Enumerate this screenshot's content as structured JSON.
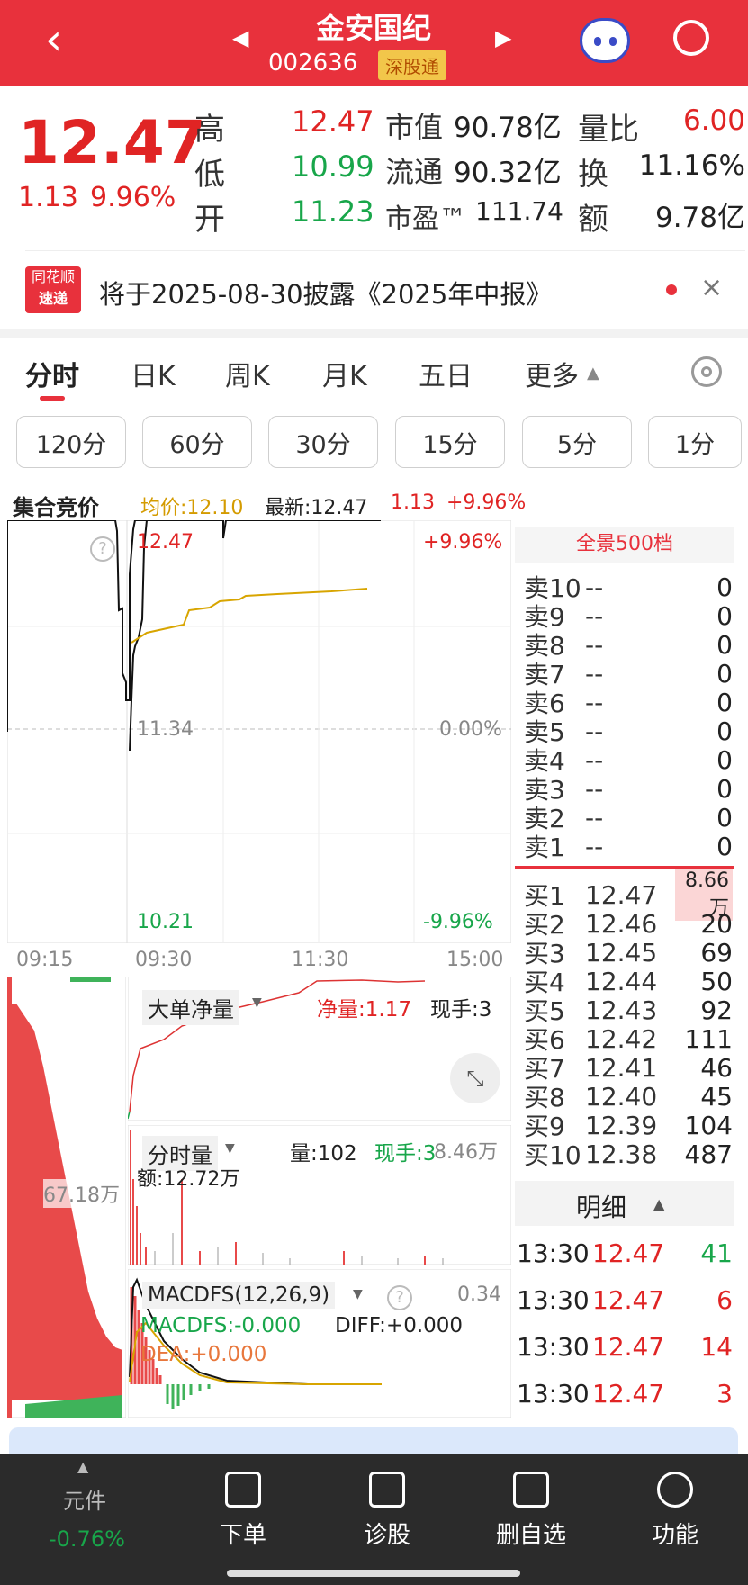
{
  "header": {
    "title": "金安国纪",
    "code": "002636",
    "tag": "深股通"
  },
  "quote": {
    "price": "12.47",
    "change": "1.13",
    "change_pct": "9.96%",
    "rows": [
      {
        "a_label": "高",
        "a_val": "12.47",
        "b_label": "市值",
        "b_val": "90.78亿",
        "c_label": "量比",
        "c_val": "6.00"
      },
      {
        "a_label": "低",
        "a_val": "10.99",
        "b_label": "流通",
        "b_val": "90.32亿",
        "c_label": "换",
        "c_val": "11.16%"
      },
      {
        "a_label": "开",
        "a_val": "11.23",
        "b_label": "市盈™",
        "b_val": "111.74",
        "c_label": "额",
        "c_val": "9.78亿"
      }
    ]
  },
  "notice": {
    "badge_top": "同花顺",
    "badge_bottom": "速递",
    "text": "将于2025-08-30披露《2025年中报》"
  },
  "tabs": [
    "分时",
    "日K",
    "周K",
    "月K",
    "五日",
    "更多"
  ],
  "periods": [
    "120分",
    "60分",
    "30分",
    "15分",
    "5分",
    "1分"
  ],
  "chart": {
    "auction_label": "集合竞价",
    "avg_label": "均价:12.10",
    "latest_label": "最新:12.47",
    "chg": "1.13",
    "chg_pct": "+9.96%",
    "y_top": "12.47",
    "y_top_pct": "+9.96%",
    "y_mid": "11.34",
    "y_mid_pct": "0.00%",
    "y_bot": "10.21",
    "y_bot_pct": "-9.96%",
    "t1": "09:15",
    "t2": "09:30",
    "t3": "11:30",
    "t4": "15:00",
    "net_label": "大单净量",
    "net_value": "净量:1.17",
    "net_hand": "现手:3",
    "vol_label": "分时量",
    "vol_qty": "量:102",
    "vol_hand": "现手:3",
    "vol_right": "8.46万",
    "vol_amt": "额:12.72万",
    "auction_vol": "67.18万",
    "macd_label": "MACDFS(12,26,9)",
    "macd_right": "0.34",
    "macd_val": "MACDFS:-0.000",
    "diff_val": "DIFF:+0.000",
    "dea_val": "DEA:+0.000"
  },
  "orderbook": {
    "title": "全景500档",
    "asks": [
      {
        "label": "卖10",
        "price": "--",
        "qty": "0"
      },
      {
        "label": "卖9",
        "price": "--",
        "qty": "0"
      },
      {
        "label": "卖8",
        "price": "--",
        "qty": "0"
      },
      {
        "label": "卖7",
        "price": "--",
        "qty": "0"
      },
      {
        "label": "卖6",
        "price": "--",
        "qty": "0"
      },
      {
        "label": "卖5",
        "price": "--",
        "qty": "0"
      },
      {
        "label": "卖4",
        "price": "--",
        "qty": "0"
      },
      {
        "label": "卖3",
        "price": "--",
        "qty": "0"
      },
      {
        "label": "卖2",
        "price": "--",
        "qty": "0"
      },
      {
        "label": "卖1",
        "price": "--",
        "qty": "0"
      }
    ],
    "bids": [
      {
        "label": "买1",
        "price": "12.47",
        "qty": "8.66万"
      },
      {
        "label": "买2",
        "price": "12.46",
        "qty": "20"
      },
      {
        "label": "买3",
        "price": "12.45",
        "qty": "69"
      },
      {
        "label": "买4",
        "price": "12.44",
        "qty": "50"
      },
      {
        "label": "买5",
        "price": "12.43",
        "qty": "92"
      },
      {
        "label": "买6",
        "price": "12.42",
        "qty": "111"
      },
      {
        "label": "买7",
        "price": "12.41",
        "qty": "46"
      },
      {
        "label": "买8",
        "price": "12.40",
        "qty": "45"
      },
      {
        "label": "买9",
        "price": "12.39",
        "qty": "104"
      },
      {
        "label": "买10",
        "price": "12.38",
        "qty": "487"
      }
    ]
  },
  "detail": {
    "title": "明细",
    "rows": [
      {
        "time": "13:30",
        "price": "12.47",
        "qty": "41"
      },
      {
        "time": "13:30",
        "price": "12.47",
        "qty": "6"
      },
      {
        "time": "13:30",
        "price": "12.47",
        "qty": "14"
      },
      {
        "time": "13:30",
        "price": "12.47",
        "qty": "3"
      }
    ]
  },
  "nav": {
    "component_label": "元件",
    "component_pct": "-0.76%",
    "items": [
      "下单",
      "诊股",
      "删自选",
      "功能"
    ]
  },
  "colors": {
    "header": "#e8313c",
    "up": "#e02424",
    "down": "#18a64a",
    "avg": "#d49b00"
  }
}
